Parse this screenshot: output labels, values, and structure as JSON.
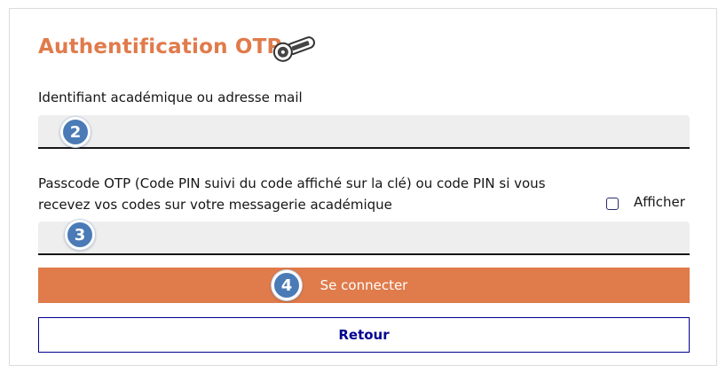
{
  "form": {
    "title": "Authentification OTP",
    "key_icon": "otp-key-icon",
    "identifier_label": "Identifiant académique ou adresse mail",
    "identifier_value": "",
    "passcode_label_line1": "Passcode OTP (Code PIN suivi du code affiché sur la clé) ou code PIN si vous",
    "passcode_label_line2": "recevez vos codes sur votre messagerie académique",
    "passcode_value": "",
    "show_label": "Afficher",
    "show_checked": false,
    "connect_label": "Se connecter",
    "back_label": "Retour"
  },
  "markers": {
    "identifier": "2",
    "passcode": "3",
    "connect": "4"
  },
  "colors": {
    "accent": "#e07b4b",
    "field_bg": "#eeeeee",
    "marker": "#4a7bb7",
    "secondary": "#000091"
  }
}
